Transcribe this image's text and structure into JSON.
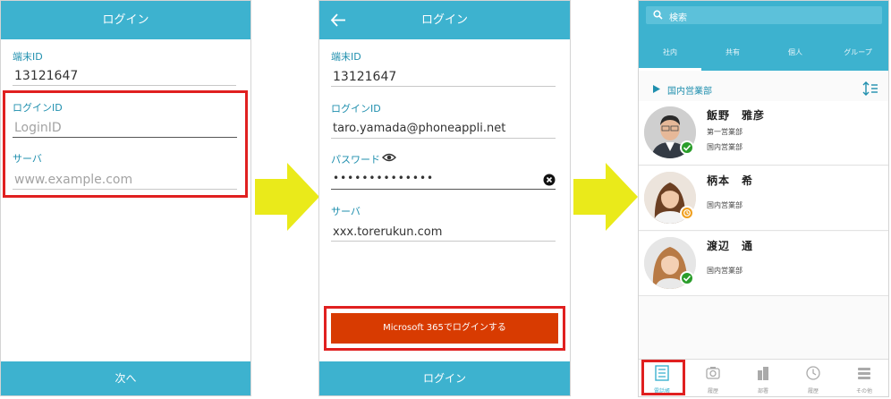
{
  "screen1": {
    "title": "ログイン",
    "terminal_id_label": "端末ID",
    "terminal_id_value": "13121647",
    "login_id_label": "ログインID",
    "login_id_placeholder": "LoginID",
    "server_label": "サーバ",
    "server_placeholder": "www.example.com",
    "next_button": "次へ"
  },
  "screen2": {
    "title": "ログイン",
    "terminal_id_label": "端末ID",
    "terminal_id_value": "13121647",
    "login_id_label": "ログインID",
    "login_id_value": "taro.yamada@phoneappli.net",
    "password_label": "パスワード",
    "password_value": "••••••••••••••",
    "server_label": "サーバ",
    "server_value": "xxx.torerukun.com",
    "ms_button": "Microsoft 365でログインする",
    "login_button": "ログイン"
  },
  "screen3": {
    "search_placeholder": "検索",
    "tabs": [
      "社内",
      "共有",
      "個人",
      "グループ"
    ],
    "active_tab": "社内",
    "section": "国内営業部",
    "contacts": [
      {
        "name": "飯野　雅彦",
        "lines": [
          "第一営業部",
          "国内営業部"
        ],
        "status": "available",
        "status_color": "#2a9d2a"
      },
      {
        "name": "柄本　希",
        "lines": [
          "国内営業部"
        ],
        "status": "away",
        "status_color": "#f0a020"
      },
      {
        "name": "渡辺　通",
        "lines": [
          "国内営業部"
        ],
        "status": "available",
        "status_color": "#2a9d2a"
      }
    ],
    "nav": [
      "電話帳",
      "履歴",
      "部署",
      "履歴",
      "その他"
    ]
  },
  "colors": {
    "accent": "#3db2cf",
    "highlight": "#e02020",
    "microsoft": "#d83b01",
    "arrow": "#eaea1a"
  }
}
